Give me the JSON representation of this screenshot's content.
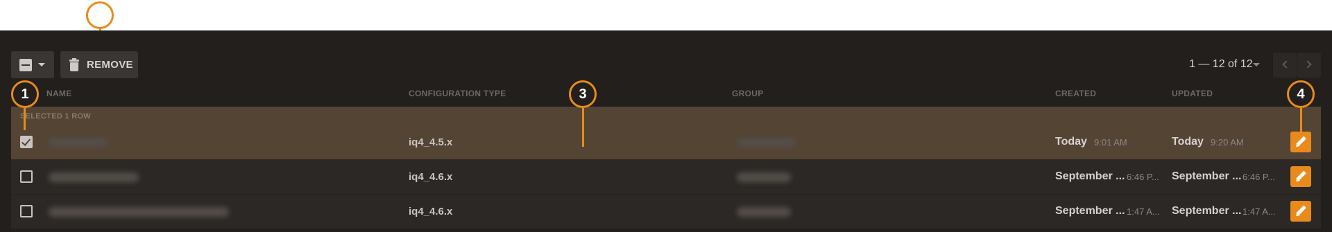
{
  "toolbar": {
    "remove_label": "REMOVE",
    "select_menu_icon": "checkbox-indeterminate-icon",
    "remove_icon": "trash-icon"
  },
  "pagination": {
    "range_text": "1 — 12 of 12",
    "prev_icon": "chevron-left-icon",
    "next_icon": "chevron-right-icon"
  },
  "table": {
    "headers": {
      "name": "NAME",
      "configuration_type": "CONFIGURATION TYPE",
      "group": "GROUP",
      "created": "CREATED",
      "updated": "UPDATED"
    },
    "selection_label": "SELECTED 1 ROW",
    "rows": [
      {
        "selected": true,
        "configuration_type": "iq4_4.5.x",
        "created_day": "Today",
        "created_time": "9:01 AM",
        "updated_day": "Today",
        "updated_time": "9:20 AM"
      },
      {
        "selected": false,
        "configuration_type": "iq4_4.6.x",
        "created_day": "September ...",
        "created_time": "6:46 P...",
        "updated_day": "September ...",
        "updated_time": "6:46 P..."
      },
      {
        "selected": false,
        "configuration_type": "iq4_4.6.x",
        "created_day": "September ...",
        "created_time": "1:47 A...",
        "updated_day": "September ...",
        "updated_time": "1:47 A..."
      }
    ]
  },
  "callouts": {
    "c1": "1",
    "c3": "3",
    "c4": "4"
  },
  "colors": {
    "accent": "#e88b1c",
    "panel_bg": "#231f1c",
    "selected_row_bg": "#544434"
  }
}
